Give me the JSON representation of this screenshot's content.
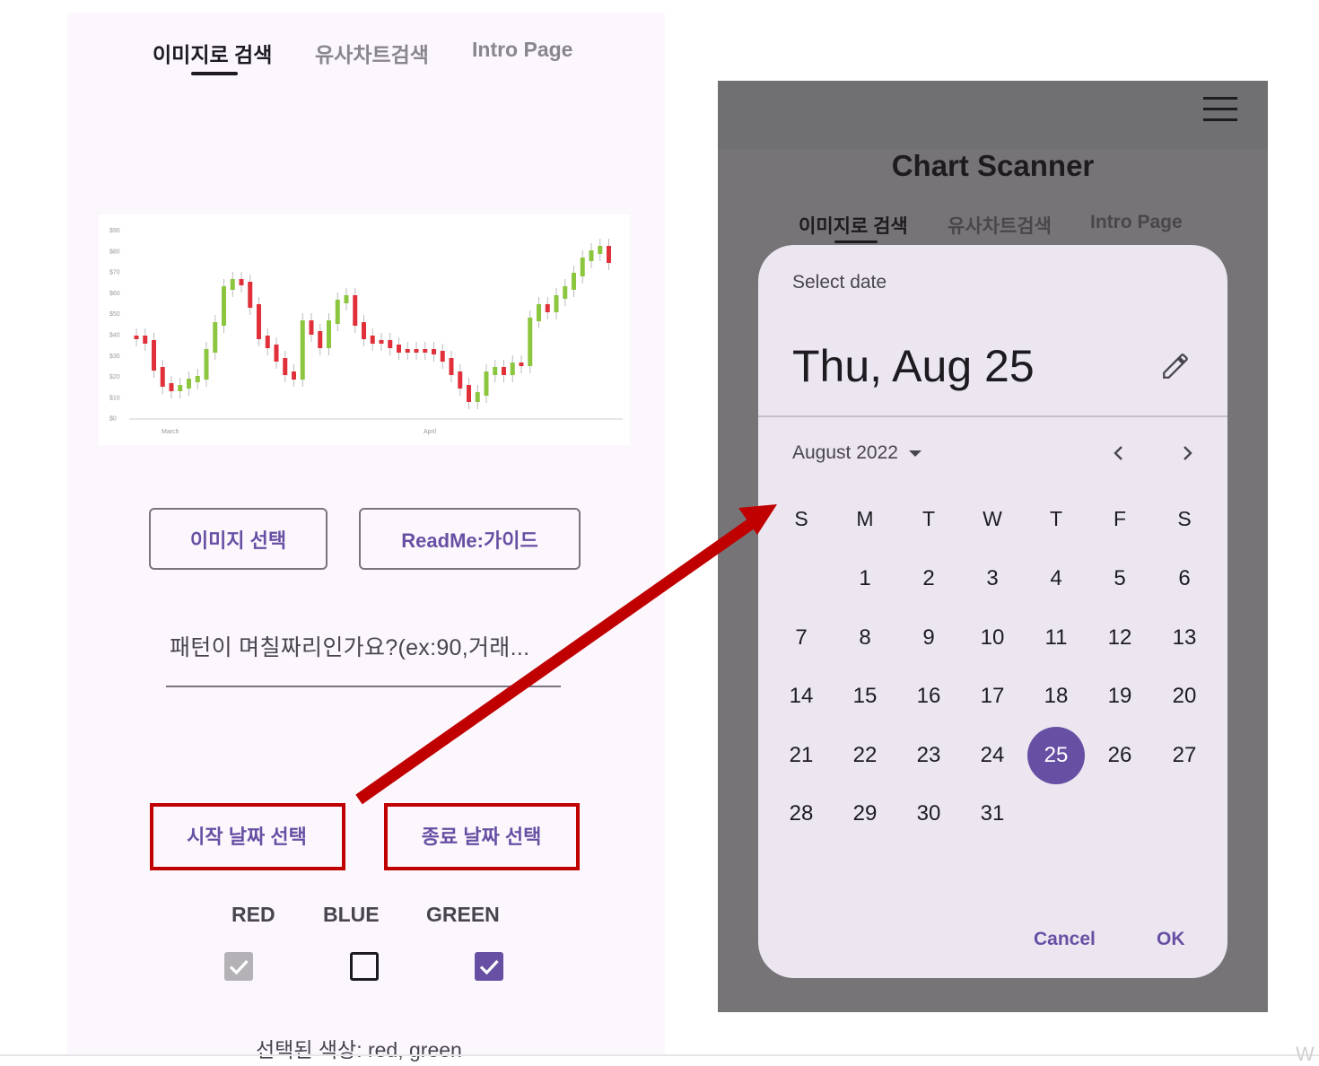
{
  "left_screen": {
    "tabs": [
      {
        "label": "이미지로 검색",
        "active": true
      },
      {
        "label": "유사차트검색",
        "active": false
      },
      {
        "label": "Intro Page",
        "active": false
      }
    ],
    "chart_tick_labels": {
      "y": [
        "$90",
        "$80",
        "$70",
        "$60",
        "$50",
        "$40",
        "$30",
        "$20",
        "$10",
        "$0"
      ],
      "x": [
        "March",
        "April"
      ]
    },
    "buttons": {
      "image_select": "이미지 선택",
      "readme": "ReadMe:가이드"
    },
    "pattern_field": {
      "placeholder": "패턴이 며칠짜리인가요?(ex:90,거래..."
    },
    "date_buttons": {
      "start": "시작 날짜 선택",
      "end": "종료 날짜 선택"
    },
    "colors": [
      {
        "label": "RED",
        "checked": true,
        "disabled": true
      },
      {
        "label": "BLUE",
        "checked": false,
        "disabled": false
      },
      {
        "label": "GREEN",
        "checked": true,
        "disabled": false
      }
    ],
    "selected_colors_text": "선택된 색상: red, green"
  },
  "right_screen": {
    "app_title": "Chart Scanner",
    "menu_icon": "hamburger-menu-icon",
    "tabs": [
      {
        "label": "이미지로 검색",
        "active": true
      },
      {
        "label": "유사차트검색",
        "active": false
      },
      {
        "label": "Intro Page",
        "active": false
      }
    ]
  },
  "date_picker": {
    "header_label": "Select date",
    "selected_date_text": "Thu, Aug 25",
    "month_label": "August 2022",
    "weekdays": [
      "S",
      "M",
      "T",
      "W",
      "T",
      "F",
      "S"
    ],
    "first_weekday_offset": 1,
    "days_in_month": 31,
    "selected_day": 25,
    "cancel_label": "Cancel",
    "ok_label": "OK"
  },
  "colors": {
    "accent": "#6750a4",
    "highlight_box": "#c00000",
    "candle_up": "#8cc63f",
    "candle_down": "#e0303a",
    "scrim": "#767476"
  }
}
